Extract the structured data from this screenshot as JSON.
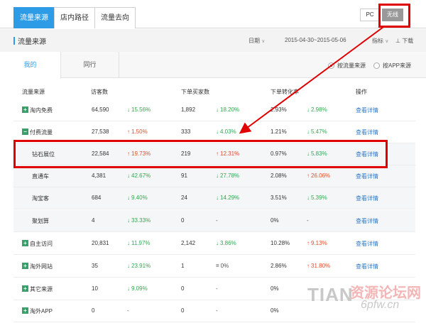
{
  "top_tabs": [
    "流量来源",
    "店内路径",
    "流量去向"
  ],
  "device": {
    "pc": "PC",
    "wireless": "无线"
  },
  "section": {
    "title": "流量来源",
    "date_label": "日期",
    "date_range": "2015-04-30~2015-05-06",
    "metric_label": "指标",
    "download_label": "下载"
  },
  "sub_tabs": {
    "mine": "我的",
    "peer": "同行"
  },
  "radio": {
    "by_source": "按流量来源",
    "by_app": "按APP来源"
  },
  "headers": [
    "流量来源",
    "访客数",
    "下单买家数",
    "下单转化率",
    "操作"
  ],
  "rows": [
    {
      "name": "淘内免费",
      "kind": "plus",
      "visitors": "64,590",
      "v_dir": "down",
      "v_pct": "15.56%",
      "buyers": "1,892",
      "b_dir": "down",
      "b_pct": "18.20%",
      "rate": "2.93%",
      "r_dir": "down",
      "r_pct": "2.98%",
      "action": "查看详情"
    },
    {
      "name": "付费流量",
      "kind": "minus",
      "visitors": "27,538",
      "v_dir": "up",
      "v_pct": "1.50%",
      "buyers": "333",
      "b_dir": "down",
      "b_pct": "4.03%",
      "rate": "1.21%",
      "r_dir": "down",
      "r_pct": "5.47%",
      "action": "查看详情"
    },
    {
      "name": "钻石展位",
      "kind": "child",
      "visitors": "22,584",
      "v_dir": "up",
      "v_pct": "19.73%",
      "buyers": "219",
      "b_dir": "up",
      "b_pct": "12.31%",
      "rate": "0.97%",
      "r_dir": "down",
      "r_pct": "5.83%",
      "action": "查看详情"
    },
    {
      "name": "直通车",
      "kind": "child",
      "visitors": "4,381",
      "v_dir": "down",
      "v_pct": "42.67%",
      "buyers": "91",
      "b_dir": "down",
      "b_pct": "27.78%",
      "rate": "2.08%",
      "r_dir": "up",
      "r_pct": "26.06%",
      "action": "查看详情"
    },
    {
      "name": "淘宝客",
      "kind": "child",
      "visitors": "684",
      "v_dir": "down",
      "v_pct": "9.40%",
      "buyers": "24",
      "b_dir": "down",
      "b_pct": "14.29%",
      "rate": "3.51%",
      "r_dir": "down",
      "r_pct": "5.39%",
      "action": "查看详情"
    },
    {
      "name": "聚划算",
      "kind": "child",
      "visitors": "4",
      "v_dir": "down",
      "v_pct": "33.33%",
      "buyers": "0",
      "b_dir": "none",
      "b_pct": "-",
      "rate": "0%",
      "r_dir": "none",
      "r_pct": "-",
      "action": "查看详情"
    },
    {
      "name": "自主访问",
      "kind": "plus",
      "visitors": "20,831",
      "v_dir": "down",
      "v_pct": "11.97%",
      "buyers": "2,142",
      "b_dir": "down",
      "b_pct": "3.86%",
      "rate": "10.28%",
      "r_dir": "up",
      "r_pct": "9.13%",
      "action": "查看详情"
    },
    {
      "name": "淘外网站",
      "kind": "plus",
      "visitors": "35",
      "v_dir": "down",
      "v_pct": "23.91%",
      "buyers": "1",
      "b_dir": "flat",
      "b_pct": "0%",
      "rate": "2.86%",
      "r_dir": "up",
      "r_pct": "31.80%",
      "action": "查看详情"
    },
    {
      "name": "其它来源",
      "kind": "plus",
      "visitors": "10",
      "v_dir": "down",
      "v_pct": "9.09%",
      "buyers": "0",
      "b_dir": "none",
      "b_pct": "-",
      "rate": "0%",
      "r_dir": "none",
      "r_pct": "",
      "action": ""
    },
    {
      "name": "淘外APP",
      "kind": "plus",
      "visitors": "0",
      "v_dir": "none",
      "v_pct": "-",
      "buyers": "0",
      "b_dir": "none",
      "b_pct": "-",
      "rate": "0%",
      "r_dir": "none",
      "r_pct": "",
      "action": ""
    }
  ],
  "watermark": {
    "text_en": "TIAN",
    "text_cn": "资源论坛网",
    "url": "6pfw.cn"
  },
  "colors": {
    "accent": "#2e9be6",
    "up": "#e24b2b",
    "down": "#2fa84f",
    "highlight": "#e00000",
    "toggle": "#3c9e6a"
  }
}
